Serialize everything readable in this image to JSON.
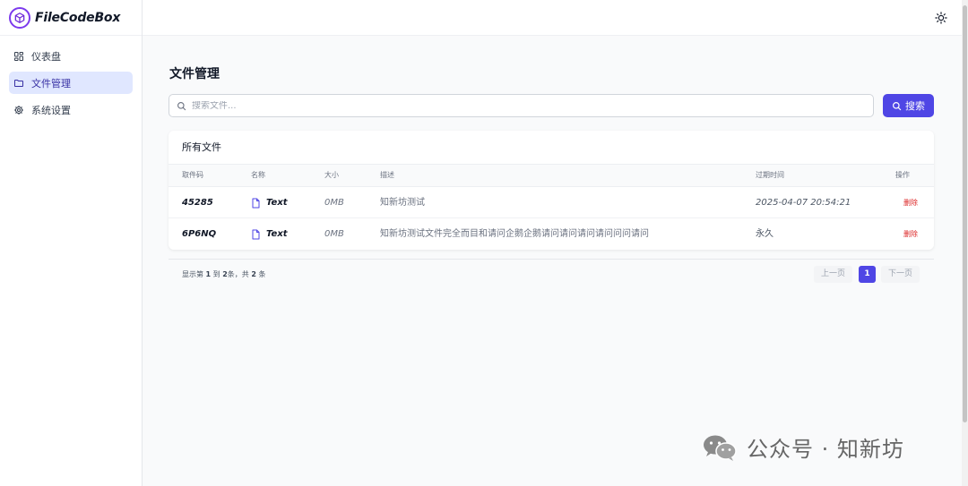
{
  "app": {
    "name": "FileCodeBox"
  },
  "sidebar": {
    "items": [
      {
        "label": "仪表盘",
        "icon": "dashboard-icon",
        "active": false
      },
      {
        "label": "文件管理",
        "icon": "folder-icon",
        "active": true
      },
      {
        "label": "系统设置",
        "icon": "gear-icon",
        "active": false
      }
    ]
  },
  "header": {
    "theme_icon": "sun-icon"
  },
  "main": {
    "title": "文件管理",
    "search": {
      "placeholder": "搜索文件...",
      "value": "",
      "button_label": "搜索"
    },
    "card_title": "所有文件",
    "table": {
      "columns": [
        "取件码",
        "名称",
        "大小",
        "描述",
        "过期时间",
        "操作"
      ],
      "rows": [
        {
          "code": "45285",
          "name": "Text",
          "size": "0MB",
          "desc": "知新坊测试",
          "expire": "2025-04-07 20:54:21",
          "action": "删除"
        },
        {
          "code": "6P6NQ",
          "name": "Text",
          "size": "0MB",
          "desc": "知新坊测试文件完全而目和请问企鹅企鹅请问请问请问请问问问请问",
          "expire": "永久",
          "action": "删除"
        }
      ]
    },
    "pagination": {
      "info_prefix": "显示第",
      "from": "1",
      "info_mid1": "到",
      "to": "2",
      "info_mid2": "条，共",
      "total": "2",
      "info_suffix": "条",
      "prev_label": "上一页",
      "current_page": "1",
      "next_label": "下一页"
    }
  },
  "watermark": {
    "text": "公众号 · 知新坊"
  },
  "colors": {
    "accent": "#4f46e5",
    "danger": "#dc2626",
    "active_bg": "#e0e7ff"
  }
}
